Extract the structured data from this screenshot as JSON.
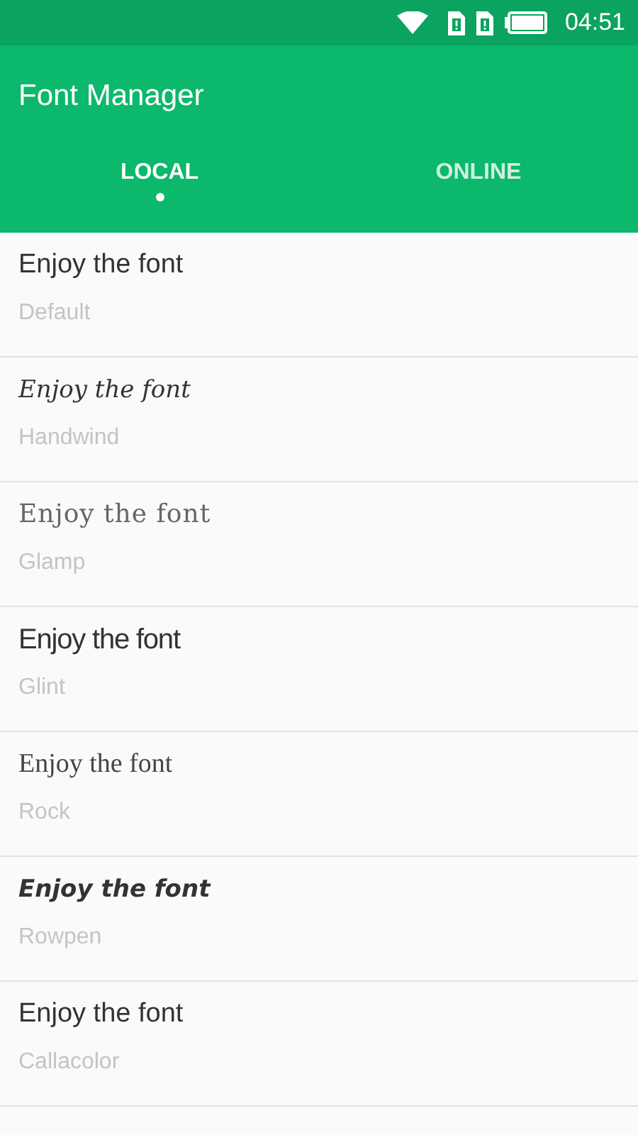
{
  "status_bar": {
    "time": "04:51"
  },
  "app_bar": {
    "title": "Font Manager"
  },
  "tabs": [
    {
      "label": "LOCAL",
      "selected": true
    },
    {
      "label": "ONLINE",
      "selected": false
    }
  ],
  "fonts": [
    {
      "sample": "Enjoy the font",
      "name": "Default",
      "kind": "default"
    },
    {
      "sample": "Enjoy the font",
      "name": "Handwind",
      "kind": "script"
    },
    {
      "sample": "Enjoy the font",
      "name": "Glamp",
      "kind": "decorative"
    },
    {
      "sample": "Enjoy the font",
      "name": "Glint",
      "kind": "narrow"
    },
    {
      "sample": "Enjoy the font",
      "name": "Rock",
      "kind": "serif"
    },
    {
      "sample": "Enjoy the font",
      "name": "Rowpen",
      "kind": "heavy"
    },
    {
      "sample": "Enjoy the font",
      "name": "Callacolor",
      "kind": "default"
    }
  ]
}
